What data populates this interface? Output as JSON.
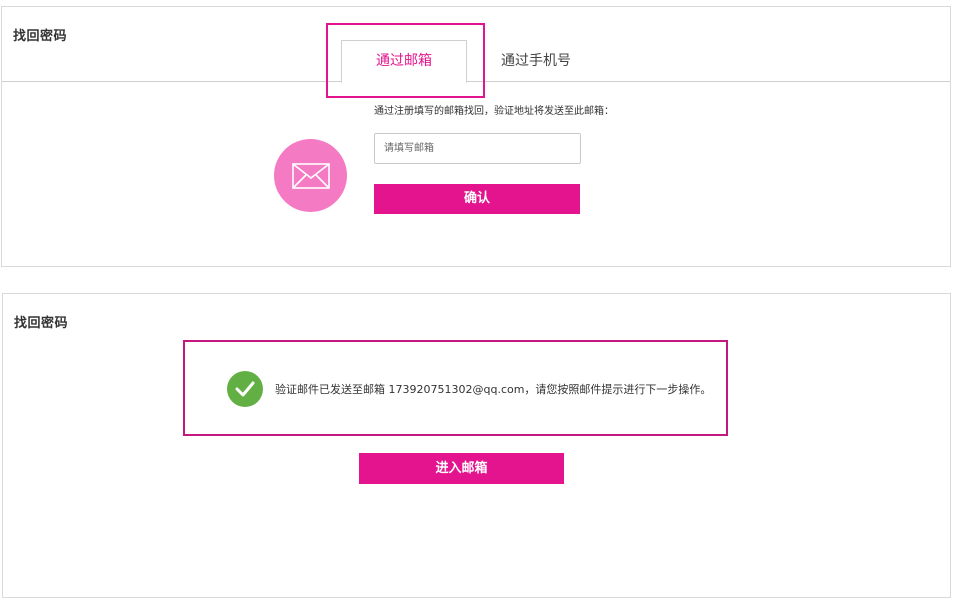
{
  "find_panel": {
    "title": "找回密码",
    "tabs": [
      {
        "label": "通过邮箱",
        "active": true
      },
      {
        "label": "通过手机号",
        "active": false
      }
    ],
    "hint": "通过注册填写的邮箱找回，验证地址将发送至此邮箱：",
    "email_placeholder": "请填写邮箱",
    "email_value": "",
    "confirm_label": "确认",
    "mail_icon": "envelope-icon"
  },
  "sent_panel": {
    "title": "找回密码",
    "message": "验证邮件已发送至邮箱 173920751302@qq.com，请您按照邮件提示进行下一步操作。",
    "check_icon": "check-circle-icon",
    "goto_label": "进入邮箱"
  },
  "colors": {
    "accent": "#e3148e",
    "mail_circle": "#f57ac4",
    "success": "#62b043",
    "highlight_border": "#e3148e"
  }
}
